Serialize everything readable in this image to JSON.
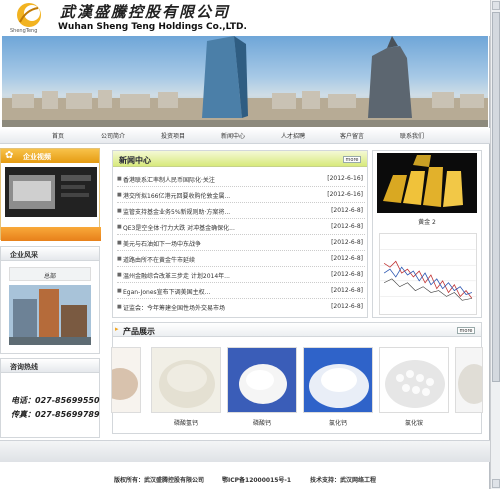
{
  "header": {
    "logo_text": "ShengTeng",
    "company_cn": "武漢盛騰控股有限公司",
    "company_en": "Wuhan Sheng Teng Holdings Co.,LTD."
  },
  "nav": [
    "首页",
    "公司简介",
    "投资项目",
    "新闻中心",
    "人才招聘",
    "客户留言",
    "联系我们"
  ],
  "video": {
    "title": "企业视频"
  },
  "style": {
    "title": "企业风采",
    "caption": "总部"
  },
  "hotline": {
    "title": "咨询热线",
    "phone_label": "电话：",
    "phone": "027-85699550",
    "fax_label": "传真：",
    "fax": "027-85699789"
  },
  "news": {
    "title": "新闻中心",
    "more": "more",
    "items": [
      {
        "title": "香港联系汇率制人民币国际化·关注",
        "date": "[2012-6-16]"
      },
      {
        "title": "港交所拟166亿港元回要收购伦敦金属...",
        "date": "[2012-6-16]"
      },
      {
        "title": "监管支持基金业务5%新规则助·方案将...",
        "date": "[2012-6-8]"
      },
      {
        "title": "QE3是空全体·行力大跌 对冲基金确保化...",
        "date": "[2012-6-8]"
      },
      {
        "title": "美元与石油如下一场中东战争",
        "date": "[2012-6-8]"
      },
      {
        "title": "道路由所不在黄金牛市延续",
        "date": "[2012-6-8]"
      },
      {
        "title": "温州金融综合改革三步走 计划2014年...",
        "date": "[2012-6-8]"
      },
      {
        "title": "Egan-Jones宣布下调美国主权...",
        "date": "[2012-6-8]"
      },
      {
        "title": "证监会：今年筹建全国性场外交易市场",
        "date": "[2012-6-8]"
      }
    ]
  },
  "right": {
    "gold_caption": "黄金 2"
  },
  "products": {
    "title": "产品展示",
    "more": "more",
    "items": [
      {
        "caption": ""
      },
      {
        "caption": "磷酸氢钙"
      },
      {
        "caption": "磷酸钙"
      },
      {
        "caption": "氯化钙"
      },
      {
        "caption": "氯化铵"
      }
    ]
  },
  "footer": {
    "left": "版权所有：武汉盛腾控股有限公司",
    "mid": "鄂ICP备12000015号-1",
    "right": "技术支持：武汉网络工程"
  },
  "colors": {
    "accent": "#e59b12",
    "news_head": "#d8ea7c"
  }
}
